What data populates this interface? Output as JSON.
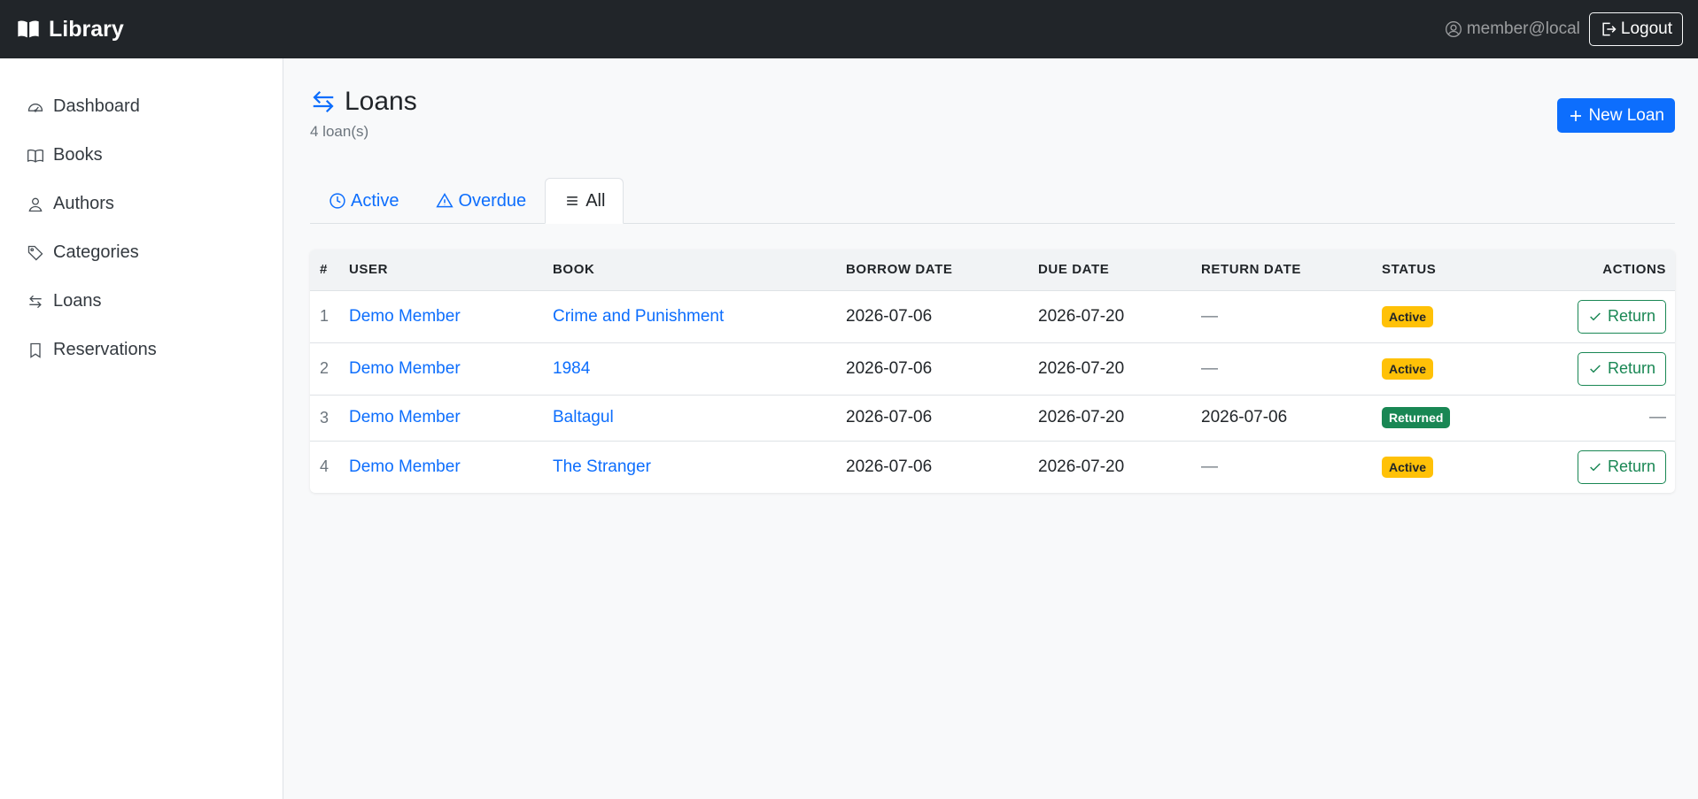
{
  "navbar": {
    "brand": "Library",
    "user": "member@local",
    "logout_label": "Logout"
  },
  "sidebar": {
    "items": [
      {
        "label": "Dashboard",
        "icon": "speedometer-icon"
      },
      {
        "label": "Books",
        "icon": "book-icon"
      },
      {
        "label": "Authors",
        "icon": "person-icon"
      },
      {
        "label": "Categories",
        "icon": "tag-icon"
      },
      {
        "label": "Loans",
        "icon": "arrows-exchange-icon"
      },
      {
        "label": "Reservations",
        "icon": "bookmark-icon"
      }
    ]
  },
  "page": {
    "title": "Loans",
    "subtitle": "4 loan(s)",
    "new_button": "New Loan"
  },
  "tabs": [
    {
      "label": "Active",
      "icon": "clock-icon"
    },
    {
      "label": "Overdue",
      "icon": "warning-icon"
    },
    {
      "label": "All",
      "icon": "list-icon",
      "active": true
    }
  ],
  "table": {
    "headers": [
      "#",
      "USER",
      "BOOK",
      "BORROW DATE",
      "DUE DATE",
      "RETURN DATE",
      "STATUS",
      "ACTIONS"
    ],
    "rows": [
      {
        "num": "1",
        "user": "Demo Member",
        "book": "Crime and Punishment",
        "borrow": "2026-07-06",
        "due": "2026-07-20",
        "return_date": "—",
        "status": "Active",
        "action": "Return"
      },
      {
        "num": "2",
        "user": "Demo Member",
        "book": "1984",
        "borrow": "2026-07-06",
        "due": "2026-07-20",
        "return_date": "—",
        "status": "Active",
        "action": "Return"
      },
      {
        "num": "3",
        "user": "Demo Member",
        "book": "Baltagul",
        "borrow": "2026-07-06",
        "due": "2026-07-20",
        "return_date": "2026-07-06",
        "status": "Returned",
        "action": "—"
      },
      {
        "num": "4",
        "user": "Demo Member",
        "book": "The Stranger",
        "borrow": "2026-07-06",
        "due": "2026-07-20",
        "return_date": "—",
        "status": "Active",
        "action": "Return"
      }
    ]
  },
  "colors": {
    "navbar": "#212529",
    "primary": "#0d6efd",
    "success": "#198754",
    "warning": "#ffc107"
  }
}
